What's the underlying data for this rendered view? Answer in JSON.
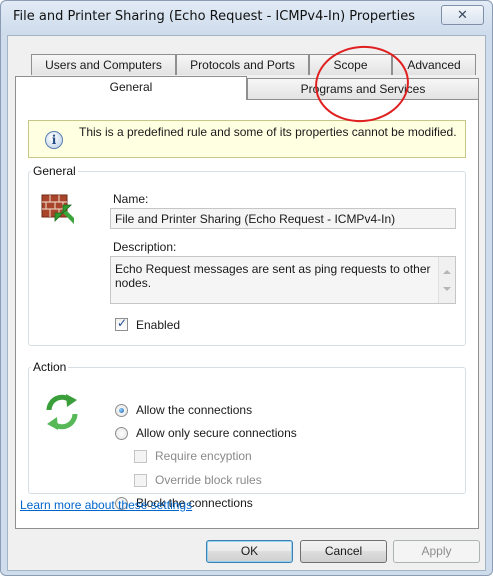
{
  "window": {
    "title": "File and Printer Sharing (Echo Request - ICMPv4-In) Properties",
    "close_symbol": "✕"
  },
  "tabs": {
    "back_row": [
      "Users and Computers",
      "Protocols and Ports",
      "Scope",
      "Advanced"
    ],
    "front_row": [
      "General",
      "Programs and Services"
    ],
    "active": "General"
  },
  "info": {
    "icon": "info-icon",
    "message": "This is a predefined rule and some of its properties cannot be modified."
  },
  "general": {
    "legend": "General",
    "icon": "firewall-icon",
    "name_label": "Name:",
    "name_value": "File and Printer Sharing (Echo Request - ICMPv4-In)",
    "description_label": "Description:",
    "description_value": "Echo Request messages are sent as ping requests to other nodes.",
    "enabled_label": "Enabled",
    "enabled": true
  },
  "action": {
    "legend": "Action",
    "icon": "refresh-arrows-icon",
    "options": [
      {
        "label": "Allow the connections",
        "selected": true
      },
      {
        "label": "Allow only secure connections",
        "selected": false
      },
      {
        "label": "Block the connections",
        "selected": false
      }
    ],
    "sub_options": [
      {
        "label": "Require encyption",
        "checked": false,
        "disabled": true
      },
      {
        "label": "Override block rules",
        "checked": false,
        "disabled": true
      }
    ]
  },
  "footer": {
    "learn_more": "Learn more about these settings",
    "ok": "OK",
    "cancel": "Cancel",
    "apply": "Apply"
  },
  "colors": {
    "info_bg": "#ffffe1",
    "link": "#0066cc",
    "annotation": "#e02020"
  }
}
